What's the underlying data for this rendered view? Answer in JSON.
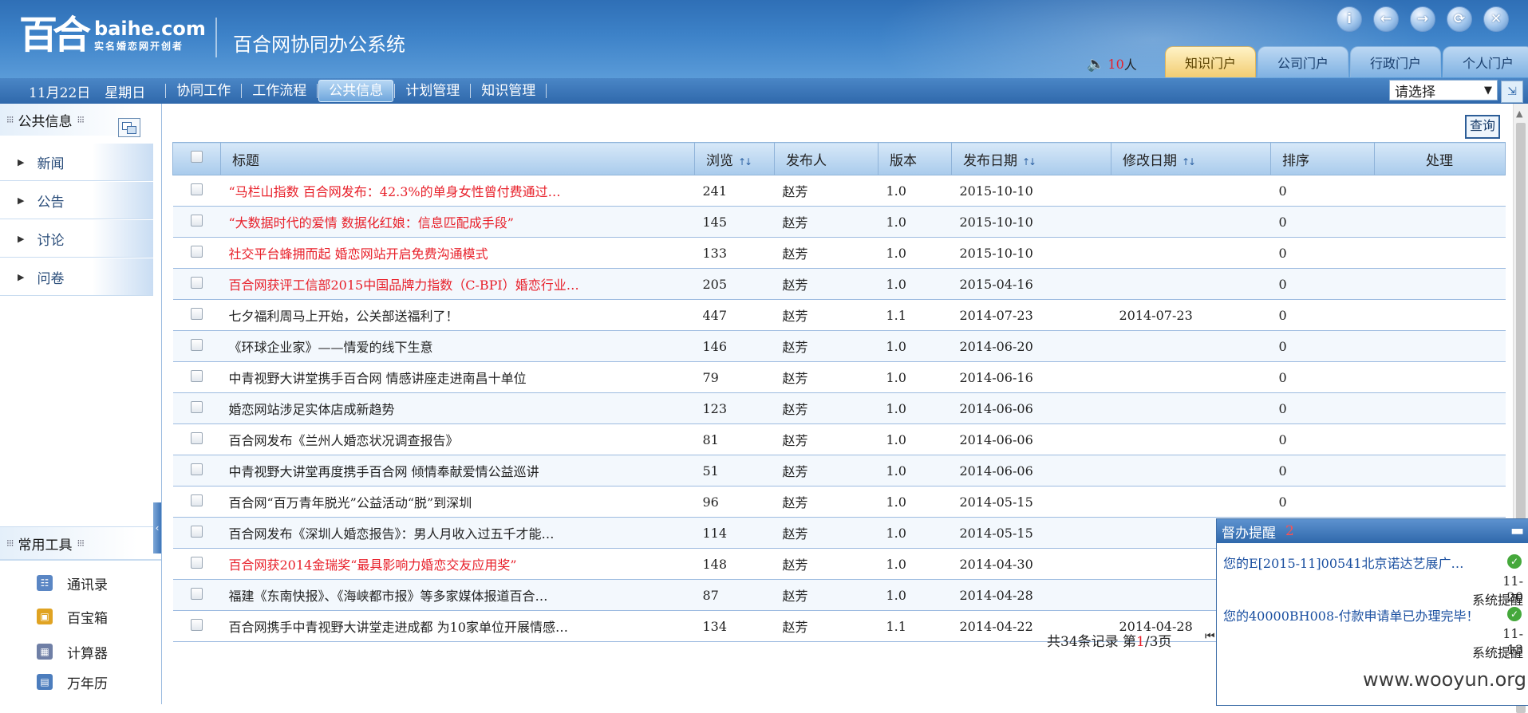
{
  "header": {
    "logo_mark": "百合",
    "logo_domain": "baihe.com",
    "logo_slogan": "实名婚恋网开创者",
    "system_title": "百合网协同办公系统",
    "top_icons": [
      "info-icon",
      "back-icon",
      "forward-icon",
      "refresh-icon",
      "close-icon"
    ],
    "online_count": "10",
    "online_unit": "人",
    "portal_tabs": [
      {
        "label": "知识门户",
        "active": true
      },
      {
        "label": "公司门户"
      },
      {
        "label": "行政门户"
      },
      {
        "label": "个人门户"
      }
    ]
  },
  "nav": {
    "date": "11月22日",
    "weekday": "星期日",
    "items": [
      {
        "label": "协同工作"
      },
      {
        "label": "工作流程"
      },
      {
        "label": "公共信息",
        "active": true
      },
      {
        "label": "计划管理"
      },
      {
        "label": "知识管理"
      }
    ],
    "select_value": "请选择"
  },
  "sidebar": {
    "section_title": "公共信息",
    "items": [
      {
        "label": "新闻"
      },
      {
        "label": "公告"
      },
      {
        "label": "讨论"
      },
      {
        "label": "问卷"
      }
    ],
    "tools_title": "常用工具",
    "tools": [
      {
        "label": "通讯录",
        "icon": "address-book-icon"
      },
      {
        "label": "百宝箱",
        "icon": "treasure-box-icon"
      },
      {
        "label": "计算器",
        "icon": "calculator-icon"
      },
      {
        "label": "万年历",
        "icon": "calendar-icon"
      }
    ]
  },
  "main": {
    "query_label": "查询",
    "columns": [
      "标题",
      "浏览",
      "发布人",
      "版本",
      "发布日期",
      "修改日期",
      "排序",
      "处理"
    ],
    "rows": [
      {
        "title": "“马栏山指数 百合网发布：42.3%的单身女性曾付费通过…",
        "views": "241",
        "author": "赵芳",
        "version": "1.0",
        "published": "2015-10-10",
        "modified": "",
        "order": "0",
        "red": true
      },
      {
        "title": "“大数据时代的爱情 数据化红娘：信息匹配成手段”",
        "views": "145",
        "author": "赵芳",
        "version": "1.0",
        "published": "2015-10-10",
        "modified": "",
        "order": "0",
        "red": true
      },
      {
        "title": "社交平台蜂拥而起 婚恋网站开启免费沟通模式",
        "views": "133",
        "author": "赵芳",
        "version": "1.0",
        "published": "2015-10-10",
        "modified": "",
        "order": "0",
        "red": true
      },
      {
        "title": "百合网获评工信部2015中国品牌力指数（C-BPI）婚恋行业…",
        "views": "205",
        "author": "赵芳",
        "version": "1.0",
        "published": "2015-04-16",
        "modified": "",
        "order": "0",
        "red": true
      },
      {
        "title": "七夕福利周马上开始，公关部送福利了！",
        "views": "447",
        "author": "赵芳",
        "version": "1.1",
        "published": "2014-07-23",
        "modified": "2014-07-23",
        "order": "0"
      },
      {
        "title": "《环球企业家》——情爱的线下生意",
        "views": "146",
        "author": "赵芳",
        "version": "1.0",
        "published": "2014-06-20",
        "modified": "",
        "order": "0"
      },
      {
        "title": "中青视野大讲堂携手百合网 情感讲座走进南昌十单位",
        "views": "79",
        "author": "赵芳",
        "version": "1.0",
        "published": "2014-06-16",
        "modified": "",
        "order": "0"
      },
      {
        "title": "婚恋网站涉足实体店成新趋势",
        "views": "123",
        "author": "赵芳",
        "version": "1.0",
        "published": "2014-06-06",
        "modified": "",
        "order": "0"
      },
      {
        "title": "百合网发布《兰州人婚恋状况调查报告》",
        "views": "81",
        "author": "赵芳",
        "version": "1.0",
        "published": "2014-06-06",
        "modified": "",
        "order": "0"
      },
      {
        "title": "中青视野大讲堂再度携手百合网 倾情奉献爱情公益巡讲",
        "views": "51",
        "author": "赵芳",
        "version": "1.0",
        "published": "2014-06-06",
        "modified": "",
        "order": "0"
      },
      {
        "title": "百合网“百万青年脱光”公益活动“脱”到深圳",
        "views": "96",
        "author": "赵芳",
        "version": "1.0",
        "published": "2014-05-15",
        "modified": "",
        "order": "0"
      },
      {
        "title": "百合网发布《深圳人婚恋报告》：男人月收入过五千才能…",
        "views": "114",
        "author": "赵芳",
        "version": "1.0",
        "published": "2014-05-15",
        "modified": "",
        "order": "0"
      },
      {
        "title": "百合网获2014金瑞奖“最具影响力婚恋交友应用奖”",
        "views": "148",
        "author": "赵芳",
        "version": "1.0",
        "published": "2014-04-30",
        "modified": "",
        "order": "",
        "red": true
      },
      {
        "title": "福建《东南快报》、《海峡都市报》等多家媒体报道百合…",
        "views": "87",
        "author": "赵芳",
        "version": "1.0",
        "published": "2014-04-28",
        "modified": "",
        "order": ""
      },
      {
        "title": "百合网携手中青视野大讲堂走进成都 为10家单位开展情感…",
        "views": "134",
        "author": "赵芳",
        "version": "1.1",
        "published": "2014-04-22",
        "modified": "2014-04-28",
        "order": ""
      }
    ],
    "pager": {
      "prefix": "共34条记录  第",
      "current": "1",
      "suffix": "/3页"
    }
  },
  "popup": {
    "title": "督办提醒",
    "count": "2",
    "items": [
      {
        "text": "您的E[2015-11]00541北京诺达艺展广…",
        "date": "11-\n20",
        "type": "系统提醒"
      },
      {
        "text": "您的40000BH008-付款申请单已办理完毕！",
        "date": "11-\n13",
        "type": "系统提醒"
      }
    ]
  },
  "watermark": "www.wooyun.org"
}
